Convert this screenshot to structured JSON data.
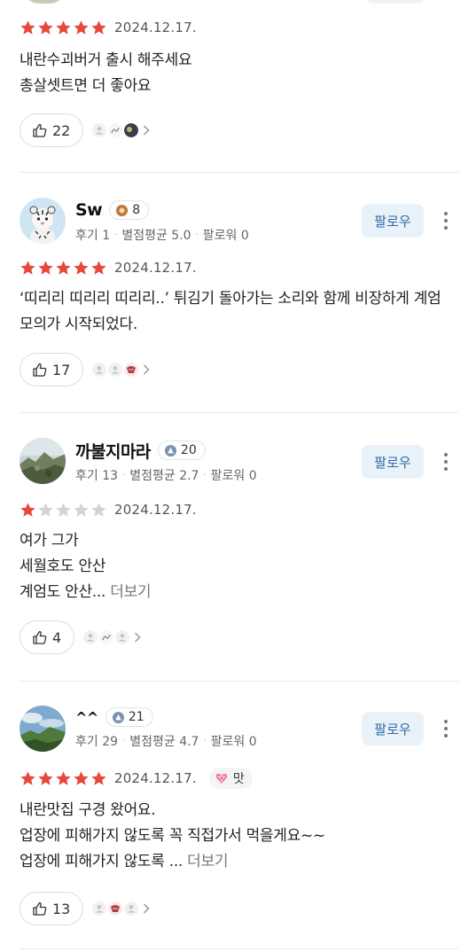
{
  "colors": {
    "star_filled": "#e8473c",
    "star_empty": "#d3d3d3",
    "follow_bg": "#eaf2f9",
    "follow_text": "#2e6aa8"
  },
  "top_partial": {
    "rating": 5,
    "date": "2024.12.17.",
    "text_lines": [
      "내란수괴버거 출시 해주세요",
      "총살셋트면 더 좋아요"
    ],
    "likes": "22"
  },
  "reviews": [
    {
      "username": "Sw",
      "level": "8",
      "level_icon": "bronze-medal-icon",
      "meta": {
        "reviews": "후기 1",
        "avg_rating": "별점평균 5.0",
        "followers": "팔로워 0"
      },
      "follow_label": "팔로우",
      "rating": 5,
      "date": "2024.12.17.",
      "text": "‘띠리리 띠리리 띠리리..’ 튀김기 돌아가는 소리와 함께 비장하게 계엄 모의가 시작되었다.",
      "likes": "17"
    },
    {
      "username": "까불지마라",
      "level": "20",
      "level_icon": "blue-rank-icon",
      "meta": {
        "reviews": "후기 13",
        "avg_rating": "별점평균 2.7",
        "followers": "팔로워 0"
      },
      "follow_label": "팔로우",
      "rating": 1,
      "date": "2024.12.17.",
      "text_lines": [
        "여가 그가",
        "세월호도 안산",
        "계엄도 안산..."
      ],
      "see_more": "더보기",
      "likes": "4"
    },
    {
      "username": "^^",
      "level": "21",
      "level_icon": "blue-rank-icon",
      "meta": {
        "reviews": "후기 29",
        "avg_rating": "별점평균 4.7",
        "followers": "팔로워 0"
      },
      "follow_label": "팔로우",
      "rating": 5,
      "date": "2024.12.17.",
      "tag": {
        "label": "맛",
        "icon": "heart-gem-icon"
      },
      "text_lines": [
        "내란맛집 구경 왔어요.",
        "업장에 피해가지 않도록 꼭 직접가서 먹을게요~~",
        "업장에 피해가지 않도록 ..."
      ],
      "see_more": "더보기",
      "likes": "13"
    }
  ]
}
